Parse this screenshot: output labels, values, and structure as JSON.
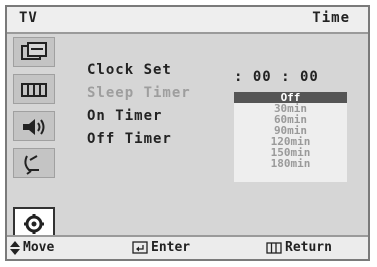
{
  "header": {
    "left": "TV",
    "right": "Time"
  },
  "sidebar": {
    "icons": [
      {
        "name": "picture-icon"
      },
      {
        "name": "channel-grid-icon"
      },
      {
        "name": "sound-icon"
      },
      {
        "name": "antenna-icon"
      },
      {
        "name": "setup-gear-icon",
        "active": true
      }
    ]
  },
  "menu": {
    "items": [
      {
        "label": "Clock Set"
      },
      {
        "label": "Sleep Timer"
      },
      {
        "label": "On Timer"
      },
      {
        "label": "Off Timer"
      }
    ],
    "clock_value": ": 00 : 00"
  },
  "sleep_dropdown": {
    "options": [
      "Off",
      "30min",
      "60min",
      "90min",
      "120min",
      "150min",
      "180min"
    ],
    "selected": "Off"
  },
  "footer": {
    "move": "Move",
    "enter": "Enter",
    "return": "Return"
  }
}
